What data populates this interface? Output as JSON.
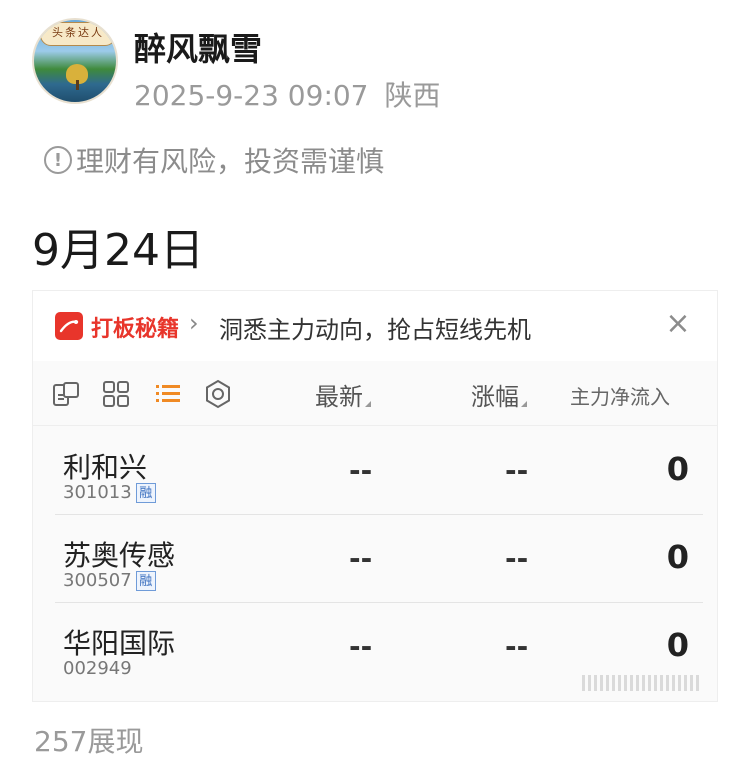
{
  "author": {
    "avatar_badge": "头条达人",
    "name": "醉风飘雪",
    "date": "2025-9-23 09:07",
    "location": "陕西"
  },
  "warning": {
    "icon": "info-circle-icon",
    "text": "理财有风险，投资需谨慎"
  },
  "post": {
    "date_heading": "9月24日"
  },
  "widget": {
    "banner": {
      "brand": "打板秘籍",
      "chevron": "›",
      "slogan": "洞悉主力动向，抢占短线先机",
      "close": "×"
    },
    "toolbar": {
      "icons": [
        "copy-panel-icon",
        "grid-icon",
        "list-icon",
        "settings-hexagon-icon"
      ],
      "columns": [
        "最新",
        "涨幅",
        "主力净流入"
      ]
    },
    "stocks": [
      {
        "name": "利和兴",
        "code": "301013",
        "tag": "融",
        "latest": "--",
        "change": "--",
        "flow": "0"
      },
      {
        "name": "苏奥传感",
        "code": "300507",
        "tag": "融",
        "latest": "--",
        "change": "--",
        "flow": "0"
      },
      {
        "name": "华阳国际",
        "code": "002949",
        "tag": "",
        "latest": "--",
        "change": "--",
        "flow": "0"
      }
    ]
  },
  "footer": {
    "views": "257展现"
  },
  "colors": {
    "brand_red": "#e8352b",
    "list_icon_orange": "#f08a24",
    "tag_blue": "#3a6fbf"
  }
}
